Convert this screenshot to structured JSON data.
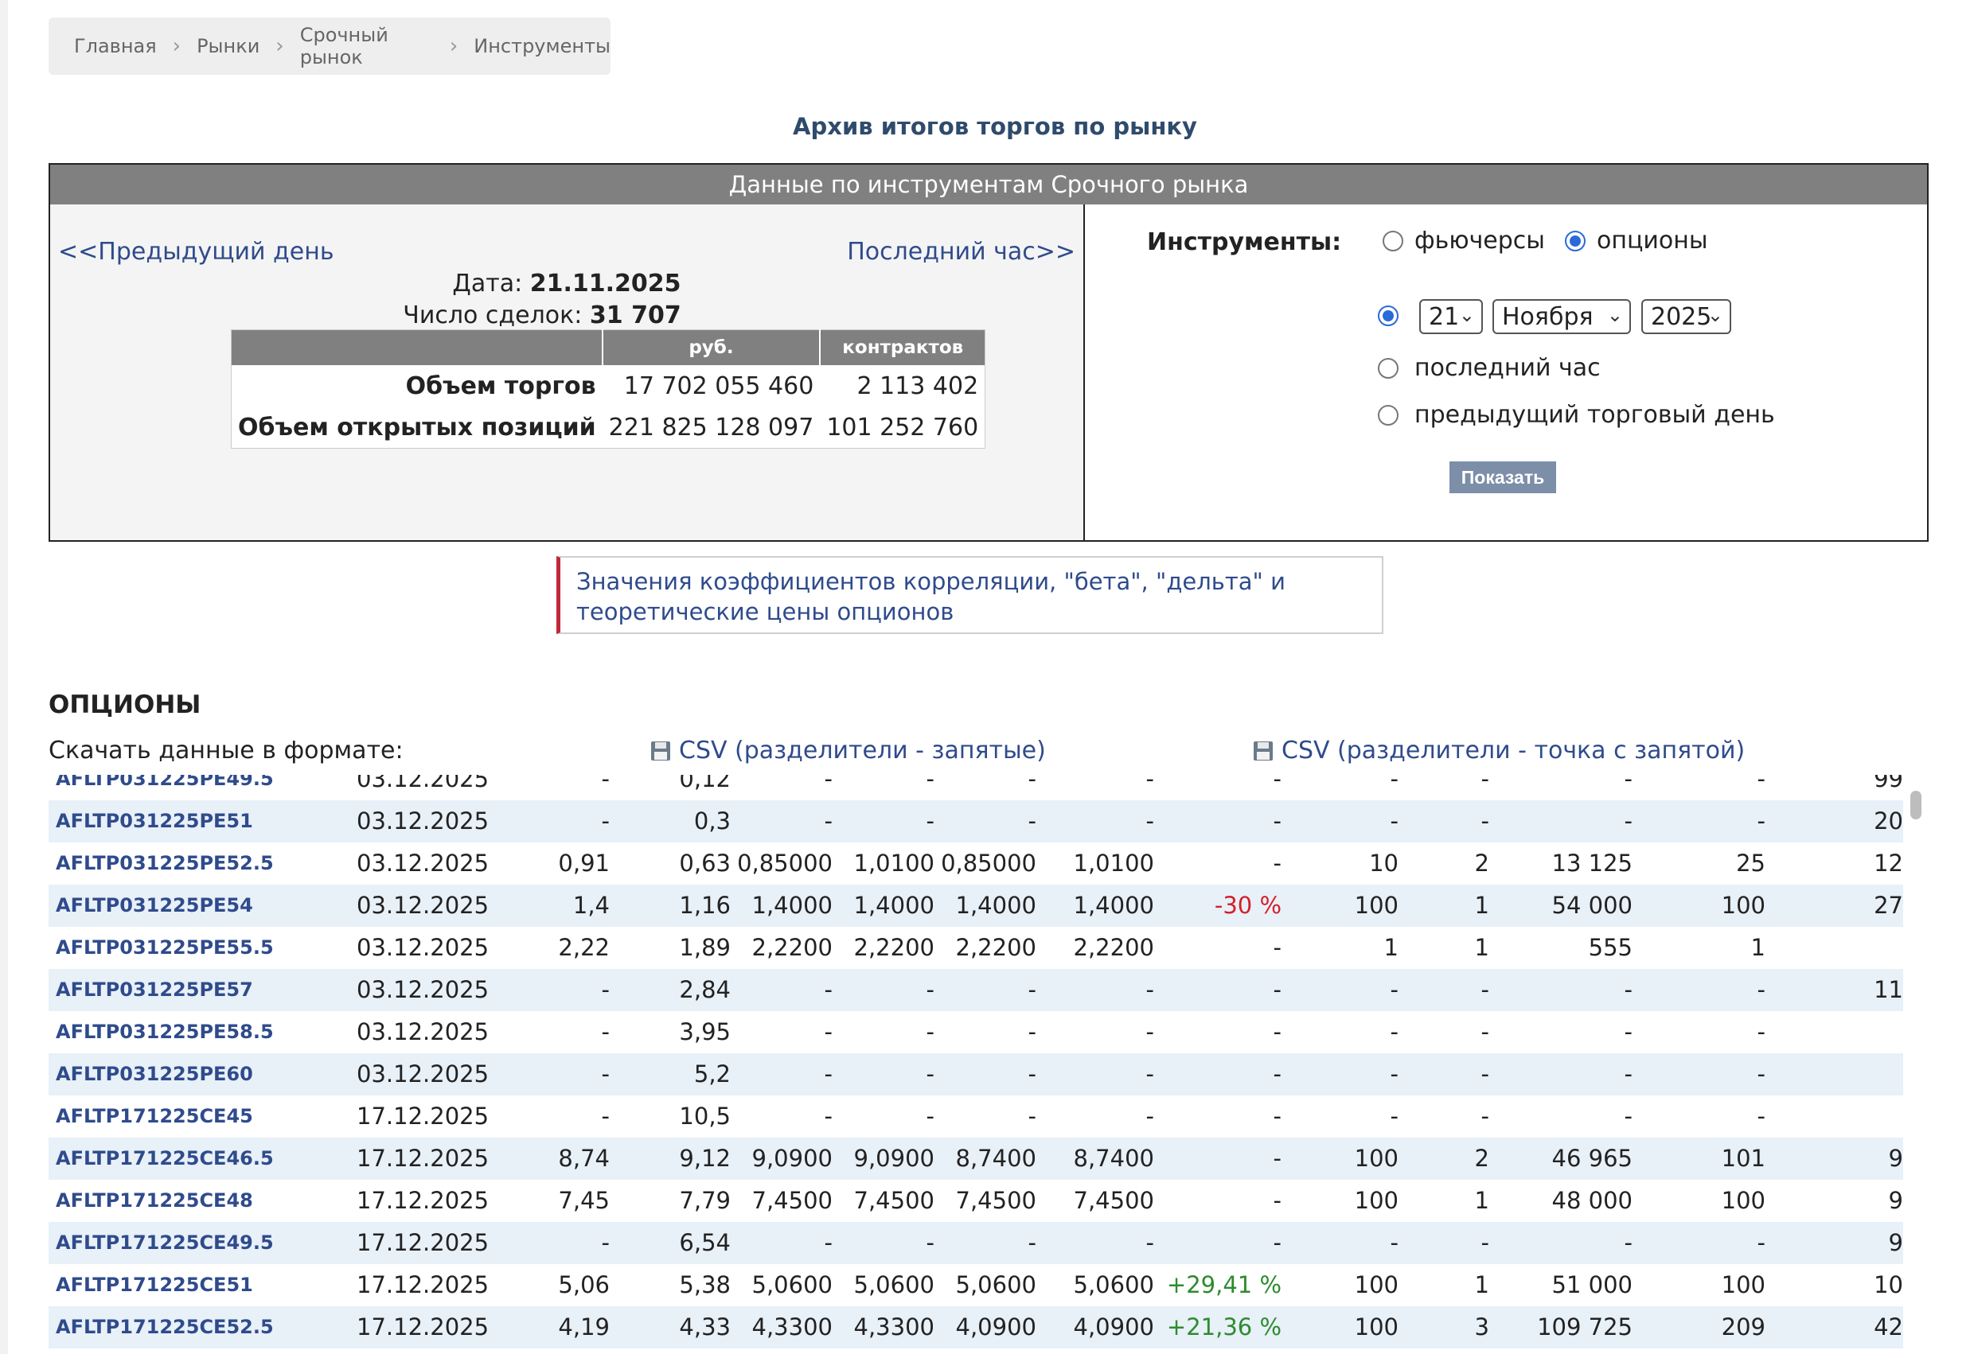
{
  "breadcrumb": [
    "Главная",
    "Рынки",
    "Срочный рынок",
    "Инструменты"
  ],
  "page_title": "Архив итогов торгов по рынку",
  "panel": {
    "header": "Данные по инструментам Срочного рынка",
    "prev_day": "<<Предыдущий день",
    "last_hour": "Последний час>>",
    "date_label": "Дата:",
    "date_value": "21.11.2025",
    "deals_label": "Число сделок:",
    "deals_value": "31 707",
    "summary": {
      "headers": [
        "",
        "руб.",
        "контрактов"
      ],
      "rows": [
        {
          "label": "Объем торгов",
          "rub": "17 702 055 460",
          "contracts": "2 113 402"
        },
        {
          "label": "Объем открытых позиций",
          "rub": "221 825 128 097",
          "contracts": "101 252 760"
        }
      ]
    }
  },
  "form": {
    "instruments_label": "Инструменты:",
    "futures": "фьючерсы",
    "options": "опционы",
    "selected_instrument": "опционы",
    "day": "21",
    "month": "Ноября",
    "year": "2025",
    "last_hour": "последний час",
    "prev_day": "предыдущий торговый день",
    "show_button": "Показать"
  },
  "notice": "Значения коэффициентов корреляции, \"бета\", \"дельта\" и теоретические цены опционов",
  "section_title": "ОПЦИОНЫ",
  "download": {
    "label": "Скачать данные в формате:",
    "csv_comma": "CSV (разделители - запятые)",
    "csv_semicolon": "CSV (разделители - точка с запятой)"
  },
  "colors": {
    "link": "#2f4b8c",
    "negative": "#d4202a",
    "positive": "#2e8b2e",
    "row_alt": "#e8f0f8"
  },
  "rows": [
    {
      "name": "AFLTP031225PE49.5",
      "date": "03.12.2025",
      "c": [
        "-",
        "0,12",
        "-",
        "-",
        "-",
        "-",
        "-",
        "-",
        "-",
        "-",
        "-",
        "99"
      ]
    },
    {
      "name": "AFLTP031225PE51",
      "date": "03.12.2025",
      "c": [
        "-",
        "0,3",
        "-",
        "-",
        "-",
        "-",
        "-",
        "-",
        "-",
        "-",
        "-",
        "20"
      ]
    },
    {
      "name": "AFLTP031225PE52.5",
      "date": "03.12.2025",
      "c": [
        "0,91",
        "0,63",
        "0,85000",
        "1,0100",
        "0,85000",
        "1,0100",
        "-",
        "10",
        "2",
        "13 125",
        "25",
        "12"
      ]
    },
    {
      "name": "AFLTP031225PE54",
      "date": "03.12.2025",
      "c": [
        "1,4",
        "1,16",
        "1,4000",
        "1,4000",
        "1,4000",
        "1,4000",
        "-30 %",
        "100",
        "1",
        "54 000",
        "100",
        "27"
      ]
    },
    {
      "name": "AFLTP031225PE55.5",
      "date": "03.12.2025",
      "c": [
        "2,22",
        "1,89",
        "2,2200",
        "2,2200",
        "2,2200",
        "2,2200",
        "-",
        "1",
        "1",
        "555",
        "1",
        ""
      ]
    },
    {
      "name": "AFLTP031225PE57",
      "date": "03.12.2025",
      "c": [
        "-",
        "2,84",
        "-",
        "-",
        "-",
        "-",
        "-",
        "-",
        "-",
        "-",
        "-",
        "11"
      ]
    },
    {
      "name": "AFLTP031225PE58.5",
      "date": "03.12.2025",
      "c": [
        "-",
        "3,95",
        "-",
        "-",
        "-",
        "-",
        "-",
        "-",
        "-",
        "-",
        "-",
        ""
      ]
    },
    {
      "name": "AFLTP031225PE60",
      "date": "03.12.2025",
      "c": [
        "-",
        "5,2",
        "-",
        "-",
        "-",
        "-",
        "-",
        "-",
        "-",
        "-",
        "-",
        ""
      ]
    },
    {
      "name": "AFLTP171225CE45",
      "date": "17.12.2025",
      "c": [
        "-",
        "10,5",
        "-",
        "-",
        "-",
        "-",
        "-",
        "-",
        "-",
        "-",
        "-",
        ""
      ]
    },
    {
      "name": "AFLTP171225CE46.5",
      "date": "17.12.2025",
      "c": [
        "8,74",
        "9,12",
        "9,0900",
        "9,0900",
        "8,7400",
        "8,7400",
        "-",
        "100",
        "2",
        "46 965",
        "101",
        "9"
      ]
    },
    {
      "name": "AFLTP171225CE48",
      "date": "17.12.2025",
      "c": [
        "7,45",
        "7,79",
        "7,4500",
        "7,4500",
        "7,4500",
        "7,4500",
        "-",
        "100",
        "1",
        "48 000",
        "100",
        "9"
      ]
    },
    {
      "name": "AFLTP171225CE49.5",
      "date": "17.12.2025",
      "c": [
        "-",
        "6,54",
        "-",
        "-",
        "-",
        "-",
        "-",
        "-",
        "-",
        "-",
        "-",
        "9"
      ]
    },
    {
      "name": "AFLTP171225CE51",
      "date": "17.12.2025",
      "c": [
        "5,06",
        "5,38",
        "5,0600",
        "5,0600",
        "5,0600",
        "5,0600",
        "+29,41 %",
        "100",
        "1",
        "51 000",
        "100",
        "10"
      ]
    },
    {
      "name": "AFLTP171225CE52.5",
      "date": "17.12.2025",
      "c": [
        "4,19",
        "4,33",
        "4,3300",
        "4,3300",
        "4,0900",
        "4,0900",
        "+21,36 %",
        "100",
        "3",
        "109 725",
        "209",
        "42"
      ]
    }
  ]
}
